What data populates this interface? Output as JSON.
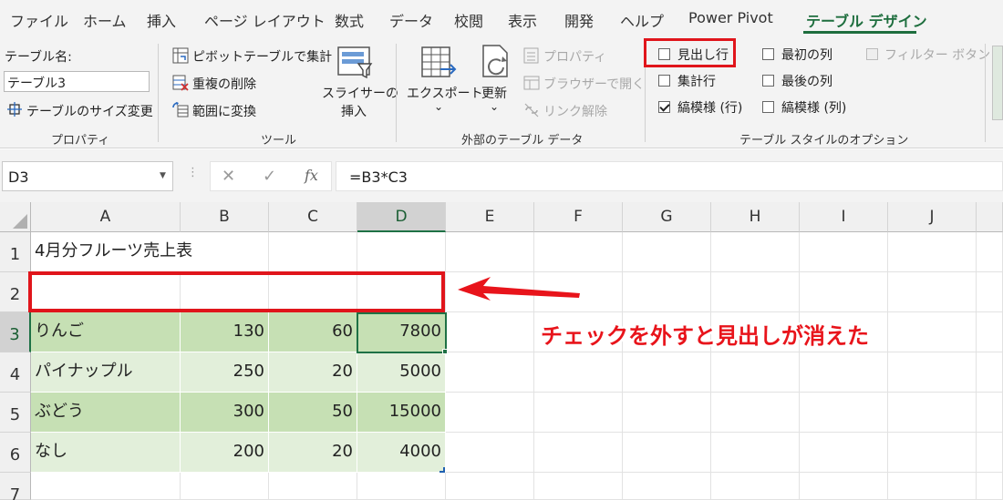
{
  "tabs": [
    {
      "label": "ファイル"
    },
    {
      "label": "ホーム"
    },
    {
      "label": "挿入"
    },
    {
      "label": "ページ レイアウト"
    },
    {
      "label": "数式"
    },
    {
      "label": "データ"
    },
    {
      "label": "校閲"
    },
    {
      "label": "表示"
    },
    {
      "label": "開発"
    },
    {
      "label": "ヘルプ"
    },
    {
      "label": "Power Pivot"
    },
    {
      "label": "テーブル デザイン"
    }
  ],
  "active_tab": "テーブル デザイン",
  "ribbon": {
    "properties": {
      "table_name_label": "テーブル名:",
      "table_name_value": "テーブル3",
      "resize_label": "テーブルのサイズ変更",
      "group_label": "プロパティ"
    },
    "tools": {
      "pivot_label": "ピボットテーブルで集計",
      "remove_dup_label": "重複の削除",
      "convert_label": "範囲に変換",
      "slicer_label_1": "スライサーの",
      "slicer_label_2": "挿入",
      "group_label": "ツール"
    },
    "external": {
      "export_label": "エクスポート",
      "refresh_label": "更新",
      "properties_label": "プロパティ",
      "browser_label": "ブラウザーで開く",
      "unlink_label": "リンク解除",
      "chevron": "⌄",
      "group_label": "外部のテーブル データ"
    },
    "style_options": {
      "header_row": {
        "label": "見出し行",
        "checked": false
      },
      "total_row": {
        "label": "集計行",
        "checked": false
      },
      "banded_rows": {
        "label": "縞模様 (行)",
        "checked": true
      },
      "first_column": {
        "label": "最初の列",
        "checked": false
      },
      "last_column": {
        "label": "最後の列",
        "checked": false
      },
      "banded_columns": {
        "label": "縞模様 (列)",
        "checked": false
      },
      "filter_button": {
        "label": "フィルター ボタン",
        "checked": false
      },
      "group_label": "テーブル スタイルのオプション"
    }
  },
  "formula_bar": {
    "name_box": "D3",
    "cancel_icon": "✕",
    "enter_icon": "✓",
    "fx_label": "fx",
    "formula": "=B3*C3"
  },
  "sheet": {
    "columns": [
      "A",
      "B",
      "C",
      "D",
      "E",
      "F",
      "G",
      "H",
      "I",
      "J"
    ],
    "rows": [
      "1",
      "2",
      "3",
      "4",
      "5",
      "6",
      "7"
    ],
    "title": "4月分フルーツ売上表",
    "data": [
      [
        "りんご",
        "130",
        "60",
        "7800"
      ],
      [
        "パイナップル",
        "250",
        "20",
        "5000"
      ],
      [
        "ぶどう",
        "300",
        "50",
        "15000"
      ],
      [
        "なし",
        "200",
        "20",
        "4000"
      ]
    ],
    "active_cell": "D3"
  },
  "annotation": {
    "text": "チェックを外すと見出しが消えた",
    "color": "#e8141b"
  }
}
